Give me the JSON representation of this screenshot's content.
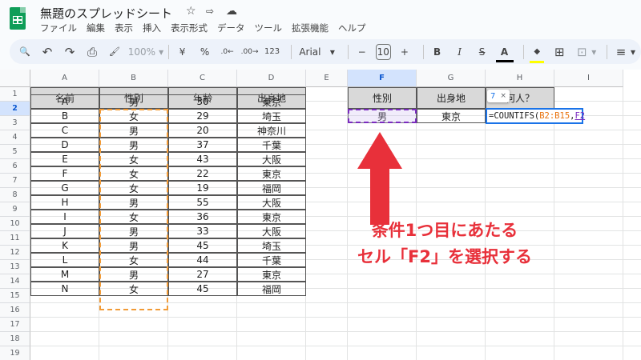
{
  "app": {
    "title": "無題のスプレッドシート",
    "star_glyph": "☆",
    "folder_glyph": "⇨",
    "cloud_glyph": "☁"
  },
  "menus": [
    "ファイル",
    "編集",
    "表示",
    "挿入",
    "表示形式",
    "データ",
    "ツール",
    "拡張機能",
    "ヘルプ"
  ],
  "toolbar": {
    "search": "🔍",
    "undo": "↶",
    "redo": "↷",
    "print": "⎙",
    "paint": "🖌",
    "zoom": "100%",
    "zoom_arrow": "▾",
    "currency": "¥",
    "percent": "%",
    "dec_down": ".0←",
    "dec_up": ".00→",
    "number_format": "123",
    "font": "Arial",
    "font_arrow": "▾",
    "minus": "−",
    "font_size": "10",
    "plus": "+",
    "bold": "B",
    "italic": "I",
    "strike": "S",
    "text_color": "A",
    "fill": "◆",
    "borders": "⊞",
    "merge": "⊡",
    "align": "≡",
    "more": "▾"
  },
  "columns": [
    "A",
    "B",
    "C",
    "D",
    "E",
    "F",
    "G",
    "H",
    "I"
  ],
  "rows": [
    "1",
    "2",
    "3",
    "4",
    "5",
    "6",
    "7",
    "8",
    "9",
    "10",
    "11",
    "12",
    "13",
    "14",
    "15",
    "16",
    "17",
    "18",
    "19"
  ],
  "table": {
    "headers": [
      "名前",
      "性別",
      "年齢",
      "出身地"
    ],
    "rows": [
      [
        "A",
        "男",
        "30",
        "東京"
      ],
      [
        "B",
        "女",
        "29",
        "埼玉"
      ],
      [
        "C",
        "男",
        "20",
        "神奈川"
      ],
      [
        "D",
        "男",
        "37",
        "千葉"
      ],
      [
        "E",
        "女",
        "43",
        "大阪"
      ],
      [
        "F",
        "女",
        "22",
        "東京"
      ],
      [
        "G",
        "女",
        "19",
        "福岡"
      ],
      [
        "H",
        "男",
        "55",
        "大阪"
      ],
      [
        "I",
        "女",
        "36",
        "東京"
      ],
      [
        "J",
        "男",
        "33",
        "大阪"
      ],
      [
        "K",
        "男",
        "45",
        "埼玉"
      ],
      [
        "L",
        "女",
        "44",
        "千葉"
      ],
      [
        "M",
        "男",
        "27",
        "東京"
      ],
      [
        "N",
        "女",
        "45",
        "福岡"
      ]
    ]
  },
  "criteria": {
    "headers": [
      "性別",
      "出身地",
      "何人？"
    ],
    "values": [
      "男",
      "東京"
    ]
  },
  "editor": {
    "prefix": "=COUNTIFS(",
    "ref1": "B2:B15",
    "comma": ",",
    "ref2": "F2"
  },
  "tooltip": {
    "value": "7",
    "close": "×"
  },
  "annotation": {
    "line1": "条件1つ目にあたる",
    "line2": "セル「F2」を選択する",
    "color": "#e8303a"
  }
}
